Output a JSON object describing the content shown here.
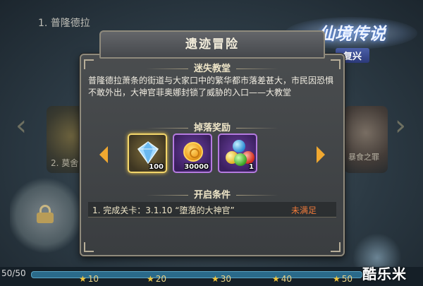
{
  "background": {
    "stage_label": "1. 普隆德拉",
    "left_stage_name": "2. 莫舍",
    "right_stage_name": "暴食之罪",
    "progress_count": "50/50",
    "milestones": [
      "10",
      "20",
      "30",
      "40",
      "50"
    ],
    "watermark": "酷乐米"
  },
  "logo": {
    "title": "仙境传说",
    "subtitle": "复兴"
  },
  "modal": {
    "title": "遗迹冒险",
    "stage_section_title": "迷失教堂",
    "description": "普隆德拉萧条的街道与大家口中的繁华都市落差甚大，市民因恐惧不敢外出，大神官菲奥娜封锁了威胁的入口——大教堂",
    "drops_title": "掉落奖励",
    "rewards": [
      {
        "icon": "diamond-icon",
        "count": "100"
      },
      {
        "icon": "coin-icon",
        "count": "30000"
      },
      {
        "icon": "orbs-icon",
        "count": "1"
      }
    ],
    "condition_title": "开启条件",
    "conditions": [
      {
        "text": "1. 完成关卡：3.1.10 “堕落的大神官”",
        "status": "未满足"
      }
    ]
  },
  "colors": {
    "accent_gold": "#f0a830",
    "status_unmet": "#f07a3a",
    "legendary_border": "#f3d66b",
    "epic_border": "#b57be0"
  }
}
